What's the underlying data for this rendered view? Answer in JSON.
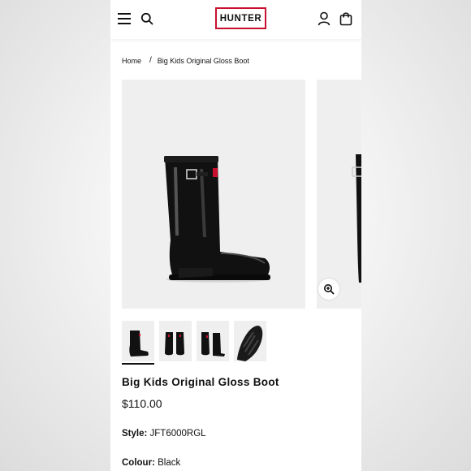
{
  "header": {
    "brand": "HUNTER",
    "brand_color": "#c8102e",
    "icons": [
      "hamburger-menu-icon",
      "search-icon",
      "account-icon",
      "shopping-bag-icon"
    ]
  },
  "breadcrumb": {
    "home": "Home",
    "separator": "/",
    "current": "Big Kids Original Gloss Boot"
  },
  "gallery": {
    "thumbnails": [
      "side view",
      "pair front view",
      "pair angled view",
      "sole view"
    ],
    "selected_thumbnail": 0,
    "zoom_icon": "zoom-in-icon"
  },
  "product": {
    "name": "Big Kids Original Gloss Boot",
    "price": "$110.00",
    "style_label": "Style:",
    "style_value": "JFT6000RGL",
    "colour_label": "Colour:",
    "colour_value": "Black"
  }
}
